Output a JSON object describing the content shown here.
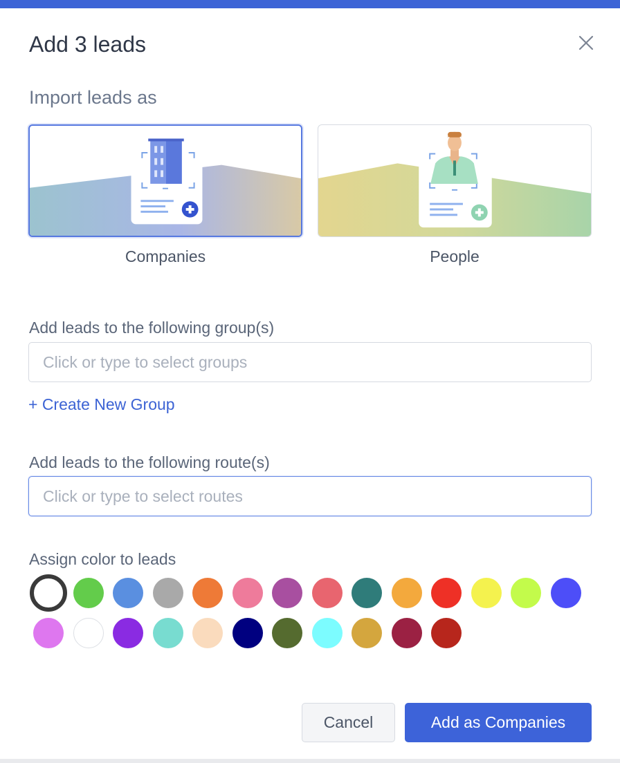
{
  "dialog": {
    "title": "Add 3 leads",
    "import_label": "Import leads as",
    "options": [
      {
        "label": "Companies",
        "selected": true,
        "icon": "building-icon"
      },
      {
        "label": "People",
        "selected": false,
        "icon": "person-icon"
      }
    ],
    "groups": {
      "label": "Add leads to the following group(s)",
      "placeholder": "Click or type to select groups",
      "value": ""
    },
    "create_group_link": "+ Create New Group",
    "routes": {
      "label": "Add leads to the following route(s)",
      "placeholder": "Click or type to select routes",
      "value": ""
    },
    "color_label": "Assign color to leads",
    "colors": [
      "#ffffff",
      "#63cc4b",
      "#5a8fe0",
      "#a9a9a9",
      "#ee7a37",
      "#ee7b9b",
      "#a84fa0",
      "#e8656f",
      "#2f7c7a",
      "#f3a93d",
      "#ee3026",
      "#f4f24e",
      "#c3fb4b",
      "#4d4ef8",
      "#de77ef",
      "#ffffff",
      "#8a2be2",
      "#78dcd0",
      "#fadbbd",
      "#000080",
      "#556b2f",
      "#7cfcff",
      "#d4a63e",
      "#9b2143",
      "#b7261c"
    ],
    "selected_color_index": 0,
    "cancel_label": "Cancel",
    "submit_label": "Add as Companies",
    "accent": "#3d63d9"
  }
}
